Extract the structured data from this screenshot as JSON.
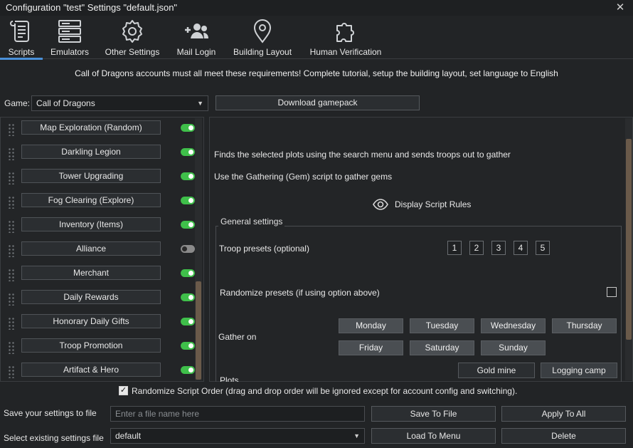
{
  "window": {
    "title": "Configuration \"test\" Settings \"default.json\"",
    "close": "✕"
  },
  "tabs": [
    {
      "label": "Scripts",
      "icon": "scroll-icon",
      "active": true
    },
    {
      "label": "Emulators",
      "icon": "server-icon"
    },
    {
      "label": "Other Settings",
      "icon": "gear-icon"
    },
    {
      "label": "Mail Login",
      "icon": "add-user-icon"
    },
    {
      "label": "Building Layout",
      "icon": "map-pin-icon"
    },
    {
      "label": "Human Verification",
      "icon": "puzzle-icon"
    }
  ],
  "banner": "Call of Dragons accounts must all meet these requirements! Complete tutorial, setup the building layout, set language to English",
  "game": {
    "label": "Game:",
    "value": "Call of Dragons",
    "download": "Download gamepack"
  },
  "scripts": [
    {
      "name": "Map Exploration (Random)",
      "enabled": true
    },
    {
      "name": "Darkling Legion",
      "enabled": true
    },
    {
      "name": "Tower Upgrading",
      "enabled": true
    },
    {
      "name": "Fog Clearing (Explore)",
      "enabled": true
    },
    {
      "name": "Inventory (Items)",
      "enabled": true
    },
    {
      "name": "Alliance",
      "enabled": false
    },
    {
      "name": "Merchant",
      "enabled": true
    },
    {
      "name": "Daily Rewards",
      "enabled": true
    },
    {
      "name": "Honorary Daily Gifts",
      "enabled": true
    },
    {
      "name": "Troop Promotion",
      "enabled": true
    },
    {
      "name": "Artifact & Hero",
      "enabled": true
    }
  ],
  "detail": {
    "desc1": "Finds the selected plots using the search menu and sends troops out to gather",
    "desc2": "Use the Gathering (Gem) script to gather gems",
    "rules": "Display Script Rules",
    "group_title": "General settings",
    "troop_presets_label": "Troop presets (optional)",
    "presets": [
      "1",
      "2",
      "3",
      "4",
      "5"
    ],
    "randomize_label": "Randomize presets (if using option above)",
    "gather_label": "Gather on",
    "days": [
      "Monday",
      "Tuesday",
      "Wednesday",
      "Thursday",
      "Friday",
      "Saturday",
      "Sunday"
    ],
    "plots_label": "Plots",
    "plots": [
      "Gold mine",
      "Logging camp"
    ]
  },
  "bottom": {
    "randomize_order": "Randomize Script Order (drag and drop order will be ignored except for account config and switching).",
    "randomize_order_checked": true,
    "save_label": "Save your settings to file",
    "filename_placeholder": "Enter a file name here",
    "save_btn": "Save To File",
    "apply_btn": "Apply To All",
    "select_label": "Select existing settings file",
    "file_value": "default",
    "load_btn": "Load To Menu",
    "delete_btn": "Delete"
  },
  "colors": {
    "toggle_on": "#3fbf4a",
    "toggle_off": "#8a8a8a",
    "accent": "#4a90d9"
  }
}
